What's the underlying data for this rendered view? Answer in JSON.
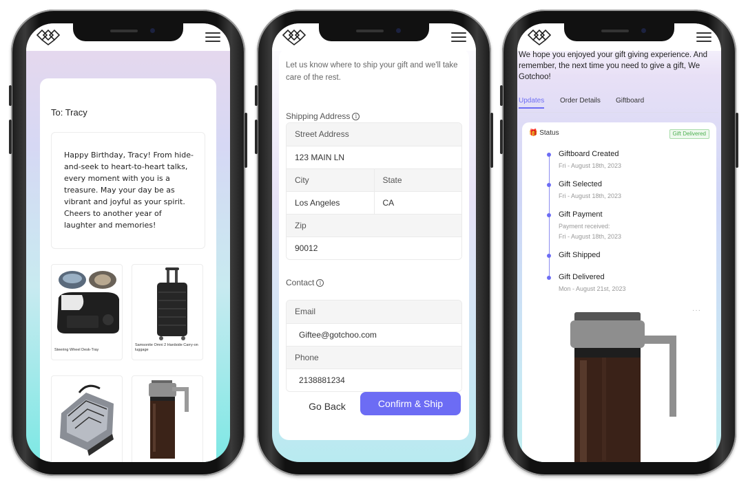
{
  "phone1": {
    "to_line": "To: Tracy",
    "message": "Happy Birthday, Tracy! From hide-and-seek to heart-to-heart talks, every moment with you is a treasure. May your day be as vibrant and joyful as your spirit. Cheers to another year of laughter and memories!",
    "products": [
      {
        "name": "Steering Wheel Desk-Tray"
      },
      {
        "name": "Samsonite Omni 2 Hardside Carry-on luggage"
      },
      {
        "name": ""
      },
      {
        "name": ""
      }
    ]
  },
  "phone2": {
    "intro": "Let us know where to ship your gift and we'll take care of the rest.",
    "shipping_label": "Shipping Address",
    "street_label": "Street Address",
    "street_value": "123 MAIN LN",
    "city_label": "City",
    "state_label": "State",
    "city_value": "Los Angeles",
    "state_value": "CA",
    "zip_label": "Zip",
    "zip_value": "90012",
    "contact_label": "Contact",
    "email_label": "Email",
    "email_value": "Giftee@gotchoo.com",
    "phone_label": "Phone",
    "phone_value": "2138881234",
    "go_back": "Go Back",
    "confirm": "Confirm & Ship"
  },
  "phone3": {
    "thanks": "We hope you enjoyed your gift giving experience. And remember, the next time you need to give a gift, We Gotchoo!",
    "tabs": [
      "Updates",
      "Order Details",
      "Giftboard"
    ],
    "status_label": "Status",
    "badge": "Gift Delivered",
    "timeline": [
      {
        "title": "Giftboard Created",
        "lines": [
          "Fri - August 18th, 2023"
        ]
      },
      {
        "title": "Gift Selected",
        "lines": [
          "Fri - August 18th, 2023"
        ]
      },
      {
        "title": "Gift Payment",
        "lines": [
          "Payment received:",
          "Fri - August 18th, 2023"
        ]
      },
      {
        "title": "Gift Shipped",
        "lines": []
      },
      {
        "title": "Gift Delivered",
        "lines": [
          "Mon - August 21st, 2023"
        ]
      }
    ],
    "more": "···"
  },
  "colors": {
    "accent": "#6c6cf4",
    "delivered": "#4caf50"
  }
}
